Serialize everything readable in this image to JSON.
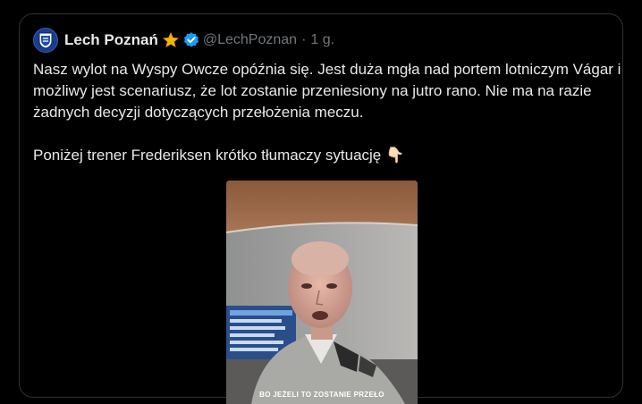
{
  "tweet": {
    "display_name": "Lech Poznań",
    "handle": "@LechPoznan",
    "separator": "·",
    "time": "1 g.",
    "paragraphs": [
      "Nasz wylot na Wyspy Owcze opóźnia się. Jest duża mgła nad portem lotniczym Vágar i możliwy jest scenariusz, że lot zostanie przeniesiony na jutro rano. Nie ma na razie żadnych decyzji dotyczących przełożenia meczu.",
      "Poniżej trener Frederiksen krótko tłumaczy sytuację"
    ],
    "emoji": "👇🏻",
    "video_caption": "BO JEŻELI TO ZOSTANIE PRZEŁO"
  },
  "icons": {
    "avatar": "lech-crest-icon",
    "star": "star-icon",
    "verified": "verified-badge-icon",
    "pointing_down": "pointing-down-hand-icon"
  },
  "colors": {
    "background": "#000000",
    "text": "#e7e9ea",
    "secondary": "#71767b",
    "border": "#2f3336",
    "verified": "#1d9bf0",
    "star": "#f4b400"
  }
}
